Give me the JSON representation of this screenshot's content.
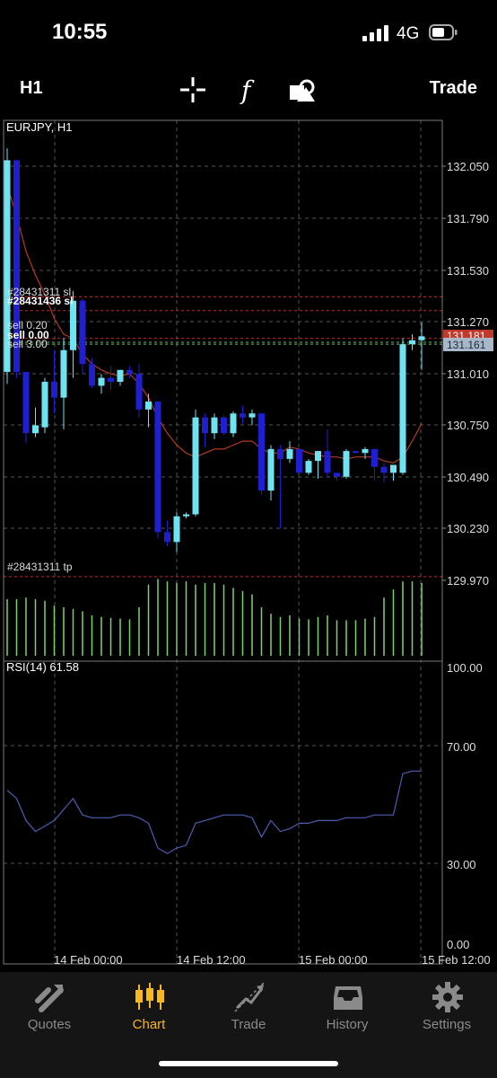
{
  "status": {
    "time": "10:55",
    "network": "4G"
  },
  "toolbar": {
    "timeframe": "H1",
    "trade_label": "Trade"
  },
  "colors": {
    "bull": "#6fe3f0",
    "bear": "#1f1fd0",
    "ma": "#b23a24",
    "rsi": "#4a5fae",
    "volume": "#7cd36e",
    "accent": "#f5b820",
    "sl_line": "#b03030",
    "bid_tag": "#c0392b",
    "ask_tag": "#a8b8c8"
  },
  "chart": {
    "symbol_label": "EURJPY, H1",
    "rsi_label": "RSI(14) 61.58",
    "price_axis": [
      "132.050",
      "131.790",
      "131.530",
      "131.270",
      "131.010",
      "130.750",
      "130.490",
      "130.230",
      "129.970"
    ],
    "rsi_axis": [
      "100.00",
      "70.00",
      "30.00",
      "0.00"
    ],
    "time_axis": [
      "14 Feb 00:00",
      "14 Feb 12:00",
      "15 Feb 00:00",
      "15 Feb 12:00"
    ],
    "price_tags": {
      "bid": "131.181",
      "ask": "131.161"
    },
    "order_labels": {
      "sl_1": "#28431311 sl",
      "sl_2": "#28431436 sl",
      "sell_1": "sell 0.20",
      "sell_2": "sell 0.00",
      "sell_3": "sell 3.00",
      "tp": "#28431311 tp"
    }
  },
  "chart_data": {
    "type": "candlestick",
    "y_range": [
      129.97,
      132.11
    ],
    "candles": [
      {
        "o": 131.01,
        "h": 132.14,
        "l": 130.95,
        "c": 132.08
      },
      {
        "o": 132.08,
        "h": 132.08,
        "l": 130.98,
        "c": 131.01
      },
      {
        "o": 131.01,
        "h": 131.01,
        "l": 130.65,
        "c": 130.7
      },
      {
        "o": 130.7,
        "h": 130.83,
        "l": 130.68,
        "c": 130.74
      },
      {
        "o": 130.73,
        "h": 130.98,
        "l": 130.7,
        "c": 130.96
      },
      {
        "o": 130.96,
        "h": 131.12,
        "l": 130.8,
        "c": 130.88
      },
      {
        "o": 130.88,
        "h": 131.18,
        "l": 130.72,
        "c": 131.12
      },
      {
        "o": 131.12,
        "h": 131.42,
        "l": 130.98,
        "c": 131.37
      },
      {
        "o": 131.37,
        "h": 131.38,
        "l": 131.0,
        "c": 131.05
      },
      {
        "o": 131.05,
        "h": 131.08,
        "l": 130.93,
        "c": 130.94
      },
      {
        "o": 130.94,
        "h": 131.0,
        "l": 130.9,
        "c": 130.98
      },
      {
        "o": 130.98,
        "h": 131.04,
        "l": 130.92,
        "c": 130.96
      },
      {
        "o": 130.96,
        "h": 131.02,
        "l": 130.94,
        "c": 131.02
      },
      {
        "o": 131.02,
        "h": 131.04,
        "l": 130.98,
        "c": 131.0
      },
      {
        "o": 131.0,
        "h": 131.05,
        "l": 130.78,
        "c": 130.82
      },
      {
        "o": 130.82,
        "h": 130.9,
        "l": 130.73,
        "c": 130.86
      },
      {
        "o": 130.86,
        "h": 130.86,
        "l": 130.17,
        "c": 130.2
      },
      {
        "o": 130.2,
        "h": 130.26,
        "l": 130.13,
        "c": 130.15
      },
      {
        "o": 130.15,
        "h": 130.3,
        "l": 130.1,
        "c": 130.28
      },
      {
        "o": 130.28,
        "h": 130.3,
        "l": 130.27,
        "c": 130.29
      },
      {
        "o": 130.29,
        "h": 130.82,
        "l": 130.28,
        "c": 130.78
      },
      {
        "o": 130.78,
        "h": 130.8,
        "l": 130.63,
        "c": 130.7
      },
      {
        "o": 130.7,
        "h": 130.8,
        "l": 130.67,
        "c": 130.78
      },
      {
        "o": 130.78,
        "h": 130.79,
        "l": 130.69,
        "c": 130.7
      },
      {
        "o": 130.7,
        "h": 130.81,
        "l": 130.68,
        "c": 130.8
      },
      {
        "o": 130.8,
        "h": 130.84,
        "l": 130.75,
        "c": 130.78
      },
      {
        "o": 130.78,
        "h": 130.82,
        "l": 130.74,
        "c": 130.8
      },
      {
        "o": 130.8,
        "h": 130.8,
        "l": 130.39,
        "c": 130.41
      },
      {
        "o": 130.41,
        "h": 130.64,
        "l": 130.36,
        "c": 130.62
      },
      {
        "o": 130.62,
        "h": 130.64,
        "l": 130.22,
        "c": 130.57
      },
      {
        "o": 130.57,
        "h": 130.66,
        "l": 130.55,
        "c": 130.62
      },
      {
        "o": 130.62,
        "h": 130.62,
        "l": 130.47,
        "c": 130.5
      },
      {
        "o": 130.5,
        "h": 130.57,
        "l": 130.49,
        "c": 130.56
      },
      {
        "o": 130.56,
        "h": 130.6,
        "l": 130.47,
        "c": 130.61
      },
      {
        "o": 130.61,
        "h": 130.72,
        "l": 130.48,
        "c": 130.5
      },
      {
        "o": 130.5,
        "h": 130.5,
        "l": 130.46,
        "c": 130.48
      },
      {
        "o": 130.48,
        "h": 130.62,
        "l": 130.47,
        "c": 130.61
      },
      {
        "o": 130.61,
        "h": 130.61,
        "l": 130.6,
        "c": 130.6
      },
      {
        "o": 130.6,
        "h": 130.63,
        "l": 130.57,
        "c": 130.62
      },
      {
        "o": 130.62,
        "h": 130.62,
        "l": 130.46,
        "c": 130.53
      },
      {
        "o": 130.53,
        "h": 130.55,
        "l": 130.45,
        "c": 130.5
      },
      {
        "o": 130.5,
        "h": 130.52,
        "l": 130.46,
        "c": 130.54
      },
      {
        "o": 130.5,
        "h": 131.18,
        "l": 130.49,
        "c": 131.15
      },
      {
        "o": 131.15,
        "h": 131.2,
        "l": 131.12,
        "c": 131.17
      },
      {
        "o": 131.17,
        "h": 131.26,
        "l": 131.02,
        "c": 131.19
      }
    ],
    "moving_average": [
      131.95,
      131.8,
      131.62,
      131.5,
      131.4,
      131.28,
      131.2,
      131.18,
      131.1,
      131.05,
      131.02,
      131.0,
      130.99,
      131.0,
      130.95,
      130.88,
      130.78,
      130.7,
      130.64,
      130.6,
      130.58,
      130.6,
      130.62,
      130.62,
      130.64,
      130.66,
      130.66,
      130.62,
      130.6,
      130.6,
      130.63,
      130.62,
      130.6,
      130.59,
      130.58,
      130.58,
      130.57,
      130.58,
      130.58,
      130.58,
      130.56,
      130.55,
      130.58,
      130.66,
      130.75
    ],
    "volume_rel": [
      0.7,
      0.7,
      0.72,
      0.7,
      0.68,
      0.62,
      0.6,
      0.58,
      0.55,
      0.5,
      0.48,
      0.47,
      0.46,
      0.45,
      0.6,
      0.88,
      0.95,
      0.92,
      0.9,
      0.92,
      0.88,
      0.9,
      0.9,
      0.88,
      0.84,
      0.8,
      0.76,
      0.6,
      0.52,
      0.48,
      0.5,
      0.46,
      0.45,
      0.48,
      0.5,
      0.44,
      0.44,
      0.44,
      0.46,
      0.48,
      0.72,
      0.82,
      0.92,
      0.92,
      0.9
    ],
    "rsi": [
      55,
      52,
      44,
      40,
      42,
      44,
      48,
      52,
      46,
      45,
      45,
      45,
      46,
      46,
      45,
      43,
      34,
      32,
      34,
      35,
      43,
      44,
      45,
      46,
      46,
      46,
      45,
      38,
      44,
      40,
      41,
      43,
      43,
      44,
      44,
      44,
      45,
      45,
      45,
      46,
      46,
      46,
      61,
      62,
      62
    ],
    "rsi_range": [
      0,
      100
    ],
    "levels": [
      131.39,
      131.32,
      131.18,
      131.16,
      131.15,
      129.975
    ]
  },
  "nav": {
    "tabs": [
      {
        "label": "Quotes"
      },
      {
        "label": "Chart"
      },
      {
        "label": "Trade"
      },
      {
        "label": "History"
      },
      {
        "label": "Settings"
      }
    ]
  }
}
